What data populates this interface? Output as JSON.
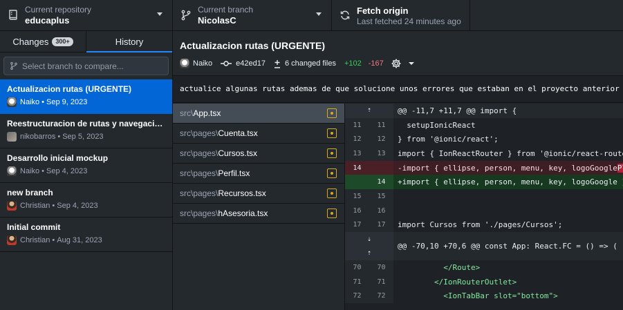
{
  "toolbar": {
    "repo": {
      "label": "Current repository",
      "value": "educaplus"
    },
    "branch": {
      "label": "Current branch",
      "value": "NicolasC"
    },
    "fetch": {
      "label": "Fetch origin",
      "sub": "Last fetched 24 minutes ago"
    }
  },
  "sidebar": {
    "tabs": [
      {
        "label": "Changes",
        "badge": "300+"
      },
      {
        "label": "History"
      }
    ],
    "compare_placeholder": "Select branch to compare...",
    "commits": [
      {
        "title": "Actualizacion rutas (URGENTE)",
        "author": "Naiko",
        "date": "Sep 9, 2023"
      },
      {
        "title": "Reestructuracion de rutas y navegacion...",
        "author": "nikobarros",
        "date": "Sep 5, 2023"
      },
      {
        "title": "Desarrollo inicial mockup",
        "author": "Naiko",
        "date": "Sep 4, 2023"
      },
      {
        "title": "new branch",
        "author": "Christian",
        "date": "Sep 4, 2023"
      },
      {
        "title": "Initial commit",
        "author": "Christian",
        "date": "Aug 31, 2023"
      }
    ]
  },
  "commit": {
    "title": "Actualizacion rutas (URGENTE)",
    "author": "Naiko",
    "sha": "e42ed17",
    "changed_files": "6 changed files",
    "additions": "+102",
    "deletions": "-167",
    "description": "actualice algunas rutas ademas de que solucione unos errores que estaban en el proyecto anterior de ionic"
  },
  "files": [
    {
      "dir": "src\\",
      "name": "App.tsx"
    },
    {
      "dir": "src\\pages\\",
      "name": "Cuenta.tsx"
    },
    {
      "dir": "src\\pages\\",
      "name": "Cursos.tsx"
    },
    {
      "dir": "src\\pages\\",
      "name": "Perfil.tsx"
    },
    {
      "dir": "src\\pages\\",
      "name": "Recursos.tsx"
    },
    {
      "dir": "src\\pages\\",
      "name": "hAsesoria.tsx"
    }
  ],
  "diff": {
    "hunk1": "@@ -11,7 +11,7 @@ import {",
    "hunk2": "@@ -70,10 +70,6 @@ const App: React.FC = () => (",
    "lines": [
      {
        "old": "11",
        "new": "11",
        "text": "  setupIonicReact"
      },
      {
        "old": "12",
        "new": "12",
        "text": "} from '@ionic/react';"
      },
      {
        "old": "13",
        "new": "13",
        "text": "import { IonReactRouter } from '@ionic/react-router';"
      },
      {
        "old": "14",
        "new": "",
        "text_before": "-import { ellipse, person, menu, key, logoGoogle",
        "text_hl": "Playst"
      },
      {
        "old": "",
        "new": "14",
        "text": "+import { ellipse, person, menu, key, logoGoogle } fro"
      },
      {
        "old": "15",
        "new": "15",
        "text": ""
      },
      {
        "old": "16",
        "new": "16",
        "text": ""
      },
      {
        "old": "17",
        "new": "17",
        "text": "import Cursos from './pages/Cursos';"
      },
      {
        "old": "70",
        "new": "70",
        "text": "          </Route>"
      },
      {
        "old": "71",
        "new": "71",
        "text": "        </IonRouterOutlet>"
      },
      {
        "old": "72",
        "new": "72",
        "text": "          <IonTabBar slot=\"bottom\">"
      }
    ]
  },
  "colors": {
    "accent": "#0366d6",
    "additions": "#34d058",
    "deletions": "#f97583",
    "modified": "#d8a920"
  }
}
